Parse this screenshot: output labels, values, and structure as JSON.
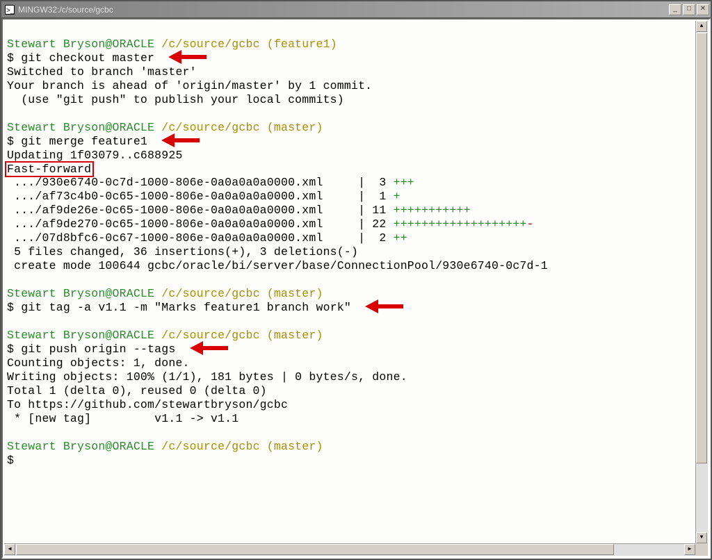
{
  "window": {
    "title": "MINGW32:/c/source/gcbc"
  },
  "colors": {
    "prompt_user": "#2a8b2a",
    "prompt_path": "#a89000",
    "diff_plus": "#2a8b2a",
    "diff_minus": "#b00000",
    "highlight": "#d80000"
  },
  "blocks": [
    {
      "prompt": {
        "user": "Stewart Bryson@ORACLE",
        "path": "/c/source/gcbc",
        "branch": "(feature1)"
      },
      "cmd": "git checkout master",
      "arrow": true,
      "out": [
        "Switched to branch 'master'",
        "Your branch is ahead of 'origin/master' by 1 commit.",
        "  (use \"git push\" to publish your local commits)"
      ]
    },
    {
      "prompt": {
        "user": "Stewart Bryson@ORACLE",
        "path": "/c/source/gcbc",
        "branch": "(master)"
      },
      "cmd": "git merge feature1",
      "arrow": true,
      "out_lines": [
        {
          "text": "Updating 1f03079..c688925"
        },
        {
          "text": "Fast-forward",
          "boxed": true
        },
        {
          "diff": {
            "file": " .../930e6740-0c7d-1000-806e-0a0a0a0a0000.xml",
            "sep": "     |  ",
            "count": "3",
            "plus": "+++",
            "minus": ""
          }
        },
        {
          "diff": {
            "file": " .../af73c4b0-0c65-1000-806e-0a0a0a0a0000.xml",
            "sep": "     |  ",
            "count": "1",
            "plus": "+",
            "minus": ""
          }
        },
        {
          "diff": {
            "file": " .../af9de26e-0c65-1000-806e-0a0a0a0a0000.xml",
            "sep": "     | ",
            "count": "11",
            "plus": "+++++++++++",
            "minus": ""
          }
        },
        {
          "diff": {
            "file": " .../af9de270-0c65-1000-806e-0a0a0a0a0000.xml",
            "sep": "     | ",
            "count": "22",
            "plus": "+++++++++++++++++++",
            "minus": "-"
          }
        },
        {
          "diff": {
            "file": " .../07d8bfc6-0c67-1000-806e-0a0a0a0a0000.xml",
            "sep": "     |  ",
            "count": "2",
            "plus": "++",
            "minus": ""
          }
        },
        {
          "text": " 5 files changed, 36 insertions(+), 3 deletions(-)"
        },
        {
          "text": " create mode 100644 gcbc/oracle/bi/server/base/ConnectionPool/930e6740-0c7d-1"
        }
      ]
    },
    {
      "prompt": {
        "user": "Stewart Bryson@ORACLE",
        "path": "/c/source/gcbc",
        "branch": "(master)"
      },
      "cmd": "git tag -a v1.1 -m \"Marks feature1 branch work\"",
      "arrow": true,
      "out": []
    },
    {
      "prompt": {
        "user": "Stewart Bryson@ORACLE",
        "path": "/c/source/gcbc",
        "branch": "(master)"
      },
      "cmd": "git push origin --tags",
      "arrow": true,
      "out": [
        "Counting objects: 1, done.",
        "Writing objects: 100% (1/1), 181 bytes | 0 bytes/s, done.",
        "Total 1 (delta 0), reused 0 (delta 0)",
        "To https://github.com/stewartbryson/gcbc",
        " * [new tag]         v1.1 -> v1.1"
      ]
    },
    {
      "prompt": {
        "user": "Stewart Bryson@ORACLE",
        "path": "/c/source/gcbc",
        "branch": "(master)"
      },
      "cmd": "",
      "arrow": false,
      "out": []
    }
  ]
}
